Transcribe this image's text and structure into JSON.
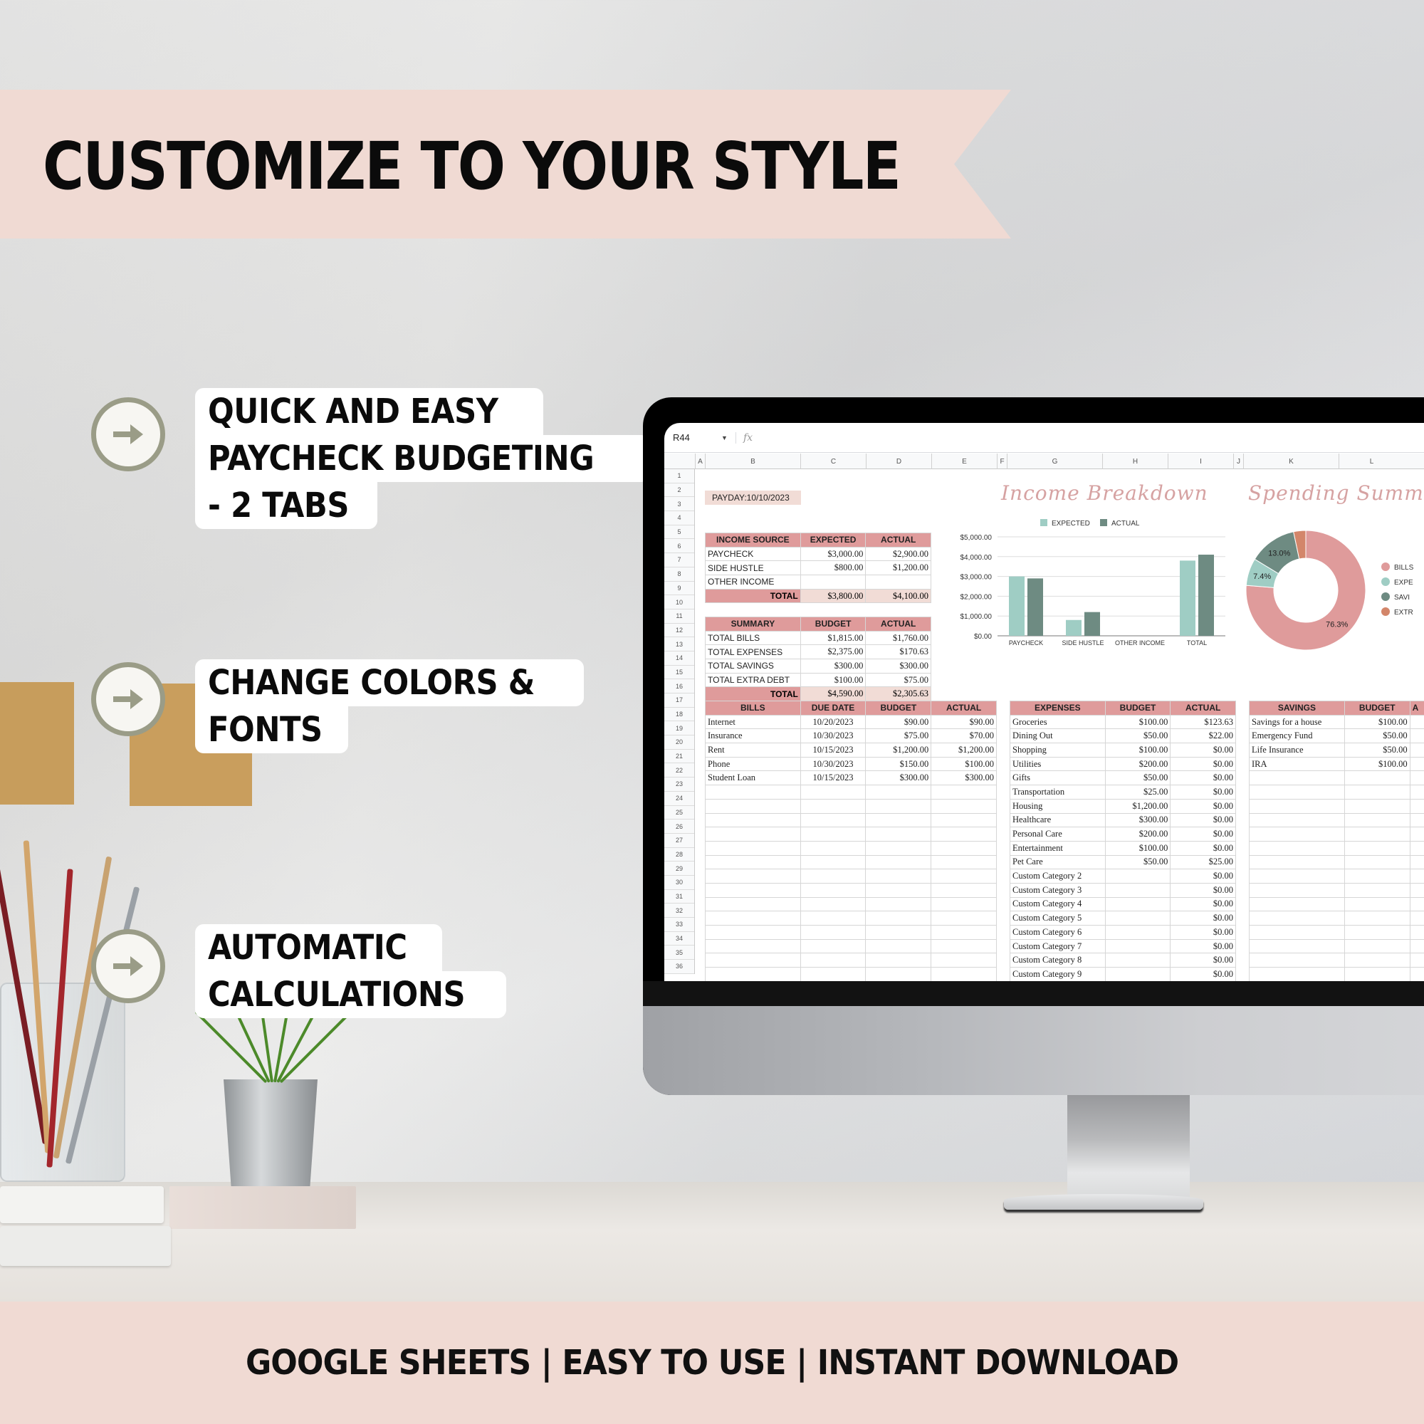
{
  "banner": {
    "title": "CUSTOMIZE TO YOUR STYLE"
  },
  "features": [
    {
      "icon": "arrow-right-icon",
      "lines": [
        "QUICK AND EASY",
        "PAYCHECK BUDGETING",
        "- 2 TABS"
      ]
    },
    {
      "icon": "arrow-right-icon",
      "lines": [
        "CHANGE COLORS &",
        "FONTS"
      ]
    },
    {
      "icon": "arrow-right-icon",
      "lines": [
        "AUTOMATIC",
        "CALCULATIONS"
      ]
    }
  ],
  "footer": {
    "text": "GOOGLE SHEETS | EASY TO USE | INSTANT DOWNLOAD"
  },
  "colors": {
    "pink_band": "#f0dad3",
    "header_pink": "#df9b9b",
    "total_fill": "#f1dcd6",
    "expected": "#9fcdc4",
    "actual": "#6e8b82",
    "bills": "#df9b9b",
    "extra_debt": "#d3866a",
    "script_title": "#d6a2a2",
    "icon_ring": "#9a9c87"
  },
  "spreadsheet": {
    "name_box": "R44",
    "formula_icon": "fx",
    "columns": [
      "A",
      "B",
      "C",
      "D",
      "E",
      "F",
      "G",
      "H",
      "I",
      "J",
      "K",
      "L"
    ],
    "rows": [
      "1",
      "2",
      "3",
      "4",
      "5",
      "6",
      "7",
      "8",
      "9",
      "10",
      "11",
      "12",
      "13",
      "14",
      "15",
      "16",
      "17",
      "18",
      "19",
      "20",
      "21",
      "22",
      "23",
      "24",
      "25",
      "26",
      "27",
      "28",
      "29",
      "30",
      "31",
      "32",
      "33",
      "34",
      "35",
      "36"
    ],
    "payday": "PAYDAY:10/10/2023",
    "income": {
      "headers": [
        "INCOME SOURCE",
        "EXPECTED",
        "ACTUAL"
      ],
      "rows": [
        [
          "PAYCHECK",
          "$3,000.00",
          "$2,900.00"
        ],
        [
          "SIDE HUSTLE",
          "$800.00",
          "$1,200.00"
        ],
        [
          "OTHER INCOME",
          "",
          ""
        ]
      ],
      "total": [
        "TOTAL",
        "$3,800.00",
        "$4,100.00"
      ]
    },
    "summary": {
      "headers": [
        "SUMMARY",
        "BUDGET",
        "ACTUAL"
      ],
      "rows": [
        [
          "TOTAL BILLS",
          "$1,815.00",
          "$1,760.00"
        ],
        [
          "TOTAL EXPENSES",
          "$2,375.00",
          "$170.63"
        ],
        [
          "TOTAL SAVINGS",
          "$300.00",
          "$300.00"
        ],
        [
          "TOTAL EXTRA DEBT",
          "$100.00",
          "$75.00"
        ]
      ],
      "total": [
        "TOTAL",
        "$4,590.00",
        "$2,305.63"
      ]
    },
    "bills": {
      "headers": [
        "BILLS",
        "DUE DATE",
        "BUDGET",
        "ACTUAL"
      ],
      "rows": [
        [
          "Internet",
          "10/20/2023",
          "$90.00",
          "$90.00"
        ],
        [
          "Insurance",
          "10/30/2023",
          "$75.00",
          "$70.00"
        ],
        [
          "Rent",
          "10/15/2023",
          "$1,200.00",
          "$1,200.00"
        ],
        [
          "Phone",
          "10/30/2023",
          "$150.00",
          "$100.00"
        ],
        [
          "Student Loan",
          "10/15/2023",
          "$300.00",
          "$300.00"
        ]
      ]
    },
    "expenses": {
      "headers": [
        "EXPENSES",
        "BUDGET",
        "ACTUAL"
      ],
      "rows": [
        [
          "Groceries",
          "$100.00",
          "$123.63"
        ],
        [
          "Dining Out",
          "$50.00",
          "$22.00"
        ],
        [
          "Shopping",
          "$100.00",
          "$0.00"
        ],
        [
          "Utilities",
          "$200.00",
          "$0.00"
        ],
        [
          "Gifts",
          "$50.00",
          "$0.00"
        ],
        [
          "Transportation",
          "$25.00",
          "$0.00"
        ],
        [
          "Housing",
          "$1,200.00",
          "$0.00"
        ],
        [
          "Healthcare",
          "$300.00",
          "$0.00"
        ],
        [
          "Personal Care",
          "$200.00",
          "$0.00"
        ],
        [
          "Entertainment",
          "$100.00",
          "$0.00"
        ],
        [
          "Pet Care",
          "$50.00",
          "$25.00"
        ],
        [
          "Custom Category 2",
          "",
          "$0.00"
        ],
        [
          "Custom Category 3",
          "",
          "$0.00"
        ],
        [
          "Custom Category 4",
          "",
          "$0.00"
        ],
        [
          "Custom Category 5",
          "",
          "$0.00"
        ],
        [
          "Custom Category 6",
          "",
          "$0.00"
        ],
        [
          "Custom Category 7",
          "",
          "$0.00"
        ],
        [
          "Custom Category 8",
          "",
          "$0.00"
        ],
        [
          "Custom Category 9",
          "",
          "$0.00"
        ]
      ]
    },
    "savings": {
      "headers": [
        "SAVINGS",
        "BUDGET",
        "A"
      ],
      "rows": [
        [
          "Savings for a house",
          "$100.00",
          ""
        ],
        [
          "Emergency Fund",
          "$50.00",
          ""
        ],
        [
          "Life Insurance",
          "$50.00",
          ""
        ],
        [
          "IRA",
          "$100.00",
          ""
        ]
      ]
    }
  },
  "chart_data": [
    {
      "type": "bar",
      "title": "Income Breakdown",
      "categories": [
        "PAYCHECK",
        "SIDE HUSTLE",
        "OTHER INCOME",
        "TOTAL"
      ],
      "series": [
        {
          "name": "EXPECTED",
          "values": [
            3000,
            800,
            0,
            3800
          ],
          "color": "#9fcdc4"
        },
        {
          "name": "ACTUAL",
          "values": [
            2900,
            1200,
            0,
            4100
          ],
          "color": "#6e8b82"
        }
      ],
      "yticks": [
        "$0.00",
        "$1,000.00",
        "$2,000.00",
        "$3,000.00",
        "$4,000.00",
        "$5,000.00"
      ],
      "ylim": [
        0,
        5000
      ],
      "legend": "top",
      "grid": true,
      "xlabel": "",
      "ylabel": ""
    },
    {
      "type": "pie",
      "title": "Spending Summ",
      "donut": true,
      "slices": [
        {
          "label": "BILLS",
          "value": 76.3,
          "color": "#df9b9b",
          "data_label": "76.3%"
        },
        {
          "label": "EXPE",
          "value": 7.4,
          "color": "#9fcdc4",
          "data_label": "7.4%"
        },
        {
          "label": "SAVI",
          "value": 13.0,
          "color": "#6e8b82",
          "data_label": "13.0%"
        },
        {
          "label": "EXTR",
          "value": 3.3,
          "color": "#d3866a",
          "data_label": ""
        }
      ],
      "legend": "right"
    }
  ]
}
